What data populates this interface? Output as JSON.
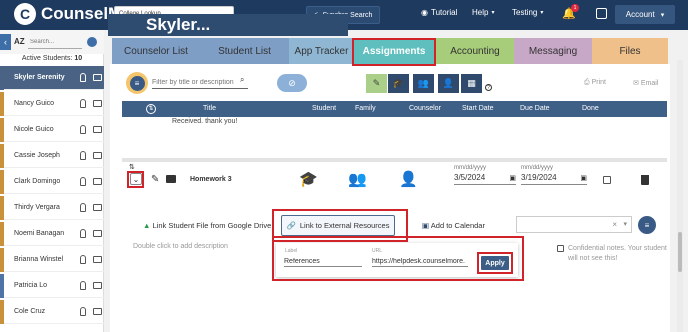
{
  "app": {
    "name": "CounselMore"
  },
  "header": {
    "college_lookup": "College Lookup",
    "synchro_search": "Synchro Search",
    "nav": [
      "Tutorial",
      "Help",
      "Testing"
    ],
    "notifications_count": "1",
    "account": "Account"
  },
  "student_header": {
    "name": "Skyler..."
  },
  "sidebar": {
    "az_label": "AZ",
    "search_placeholder": "Search...",
    "active_label": "Active Students:",
    "active_count": "10",
    "students": [
      {
        "name": "Skyler Serenity",
        "color": "#4a6283"
      },
      {
        "name": "Nancy Guico",
        "color": "#c8913a"
      },
      {
        "name": "Nicole Guico",
        "color": "#c8913a"
      },
      {
        "name": "Cassie Joseph",
        "color": "#c8913a"
      },
      {
        "name": "Clark Domingo",
        "color": "#c8913a"
      },
      {
        "name": "Thirdy Vergara",
        "color": "#c8913a"
      },
      {
        "name": "Noemi Banagan",
        "color": "#c8913a"
      },
      {
        "name": "Brianna Winstel",
        "color": "#c8913a"
      },
      {
        "name": "Patricia Lo",
        "color": "#4f74a6"
      },
      {
        "name": "Cole Cruz",
        "color": "#c8913a"
      }
    ]
  },
  "tabs": [
    {
      "label": "Counselor List",
      "color": "#7e9ec6"
    },
    {
      "label": "Student List",
      "color": "#7e9ec6"
    },
    {
      "label": "App Tracker",
      "color": "#8fb7d4"
    },
    {
      "label": "Assignments",
      "color": "#5fbfbf"
    },
    {
      "label": "Accounting",
      "color": "#a7cc7a"
    },
    {
      "label": "Messaging",
      "color": "#c7a8c7"
    },
    {
      "label": "Files",
      "color": "#f0c08a"
    }
  ],
  "toolbar": {
    "filter_placeholder": "Filter by title or description",
    "print": "Print",
    "email": "Email"
  },
  "table": {
    "columns": [
      "Title",
      "Student",
      "Family",
      "Counselor",
      "Start Date",
      "Due Date",
      "Done"
    ],
    "previous_row_text": "Received. thank you!"
  },
  "assignment": {
    "title": "Homework 3",
    "date_format_hint": "mm/dd/yyyy",
    "start_date": "3/5/2024",
    "due_date": "3/19/2024"
  },
  "actions": {
    "google_drive": "Link Student File from Google Drive",
    "external_resources": "Link to External Resources",
    "add_to_calendar": "Add to Calendar",
    "description_hint": "Double click to add description",
    "confidential": "Confidential notes. Your student will not see this!"
  },
  "link_popup": {
    "label_caption": "Label",
    "label_value": "References",
    "url_caption": "URL",
    "url_value": "https://helpdesk.counselmore.",
    "apply": "Apply"
  },
  "highlight_color": "#d1232a"
}
